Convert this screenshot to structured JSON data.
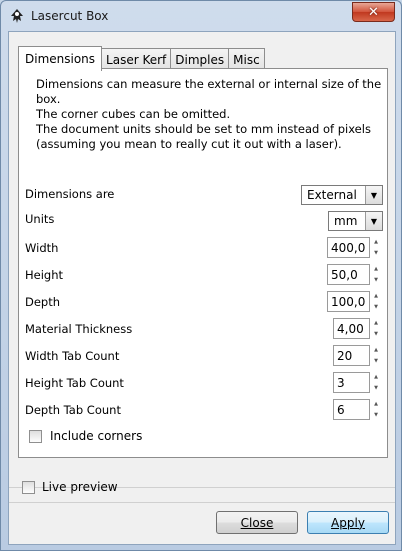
{
  "window": {
    "title": "Lasercut Box",
    "close_glyph": "✕"
  },
  "tabs": [
    {
      "label": "Dimensions",
      "active": true
    },
    {
      "label": "Laser Kerf",
      "active": false
    },
    {
      "label": "Dimples",
      "active": false
    },
    {
      "label": "Misc",
      "active": false
    }
  ],
  "description": [
    "Dimensions can measure the external or internal size of the box.",
    "The corner cubes can be omitted.",
    "The document units should be set to mm instead of pixels",
    "(assuming you mean to really cut it out with a laser)."
  ],
  "fields": {
    "dimensions_are": {
      "label": "Dimensions are",
      "value": "External"
    },
    "units": {
      "label": "Units",
      "value": "mm"
    },
    "width": {
      "label": "Width",
      "value": "400,0"
    },
    "height": {
      "label": "Height",
      "value": "50,0"
    },
    "depth": {
      "label": "Depth",
      "value": "100,0"
    },
    "material_thickness": {
      "label": "Material Thickness",
      "value": "4,00"
    },
    "width_tab_count": {
      "label": "Width Tab Count",
      "value": "20"
    },
    "height_tab_count": {
      "label": "Height Tab Count",
      "value": "3"
    },
    "depth_tab_count": {
      "label": "Depth Tab Count",
      "value": "6"
    }
  },
  "include_corners": {
    "label": "Include corners",
    "checked": false
  },
  "live_preview": {
    "label": "Live preview",
    "checked": false
  },
  "buttons": {
    "close": "Close",
    "apply": "Apply"
  },
  "icons": {
    "spin_up": "▲",
    "spin_down": "▼",
    "dropdown": "▼"
  }
}
